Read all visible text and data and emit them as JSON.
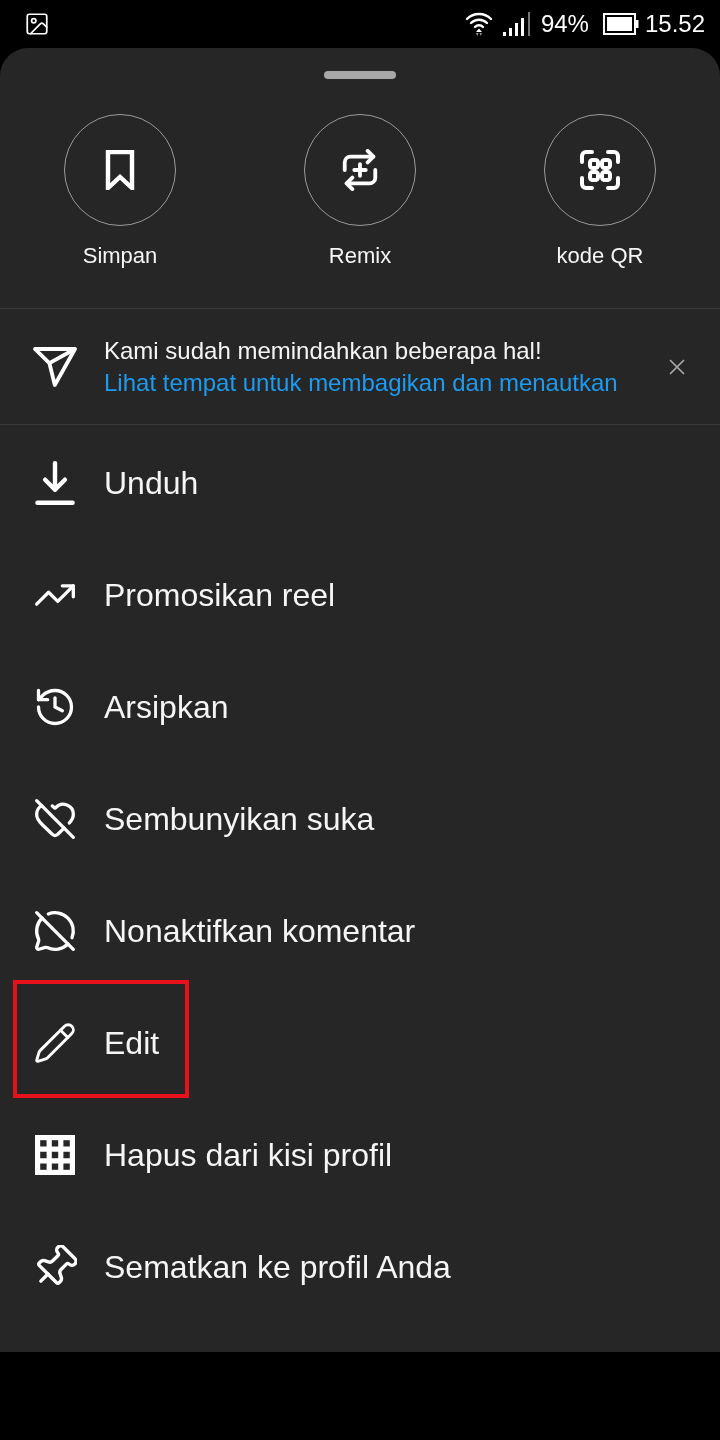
{
  "status_bar": {
    "battery_percent": "94%",
    "time": "15.52"
  },
  "sheet": {
    "quick_actions": [
      {
        "label": "Simpan",
        "kind": "bookmark"
      },
      {
        "label": "Remix",
        "kind": "remix"
      },
      {
        "label": "kode QR",
        "kind": "qr"
      }
    ],
    "notice": {
      "title": "Kami sudah memindahkan beberapa hal!",
      "link": "Lihat tempat untuk membagikan dan menautkan"
    },
    "menu_items": [
      {
        "label": "Unduh",
        "kind": "download",
        "highlighted": false
      },
      {
        "label": "Promosikan reel",
        "kind": "promote",
        "highlighted": false
      },
      {
        "label": "Arsipkan",
        "kind": "archive",
        "highlighted": false
      },
      {
        "label": "Sembunyikan suka",
        "kind": "hide_likes",
        "highlighted": false
      },
      {
        "label": "Nonaktifkan komentar",
        "kind": "comments_off",
        "highlighted": false
      },
      {
        "label": "Edit",
        "kind": "edit",
        "highlighted": true
      },
      {
        "label": "Hapus dari kisi profil",
        "kind": "grid",
        "highlighted": false
      },
      {
        "label": "Sematkan ke profil Anda",
        "kind": "pin",
        "highlighted": false
      }
    ]
  }
}
